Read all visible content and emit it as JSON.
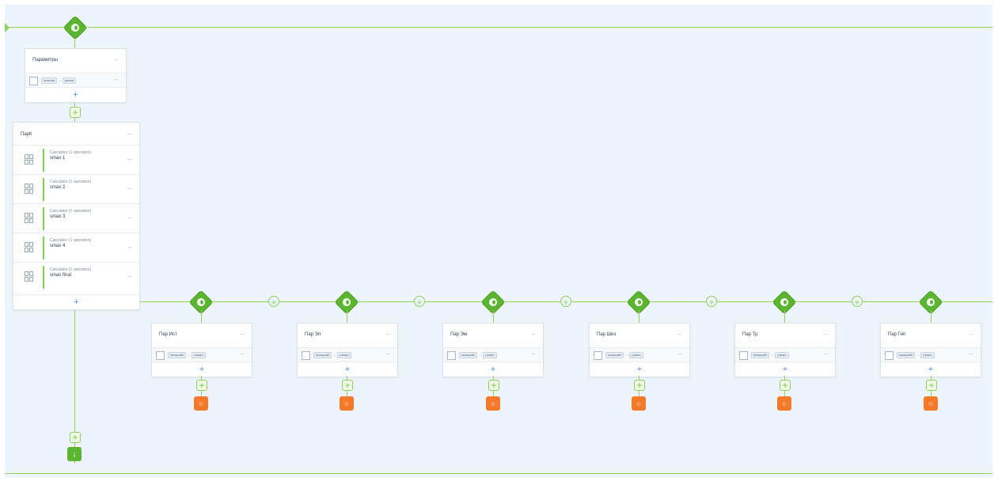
{
  "colors": {
    "canvas_bg": "#edf4fb",
    "connector": "#8fd25e",
    "gate": "#5cb531",
    "reply": "#f47a2a",
    "add": "#4a90e2"
  },
  "top_card": {
    "title": "Параметры",
    "rows": [
      {
        "from": "maxima",
        "to": "param"
      }
    ]
  },
  "calc_card": {
    "title": "ПарК",
    "operations": [
      {
        "type": "Calculator (1 operation)",
        "name": "smax 1"
      },
      {
        "type": "Calculator (1 operation)",
        "name": "smax 2"
      },
      {
        "type": "Calculator (1 operation)",
        "name": "smax 3"
      },
      {
        "type": "Calculator (1 operation)",
        "name": "smax 4"
      },
      {
        "type": "Calculator (1 operation)",
        "name": "smax final"
      }
    ]
  },
  "branch_cards": [
    {
      "title": "Пар Ист",
      "from": "smaxpath",
      "to": "param"
    },
    {
      "title": "Пар Эп",
      "from": "smaxpath",
      "to": "param"
    },
    {
      "title": "Пар Эм",
      "from": "smaxpath",
      "to": "param"
    },
    {
      "title": "Пар Шиз",
      "from": "smaxpath",
      "to": "param"
    },
    {
      "title": "Пар Тр",
      "from": "smaxpath",
      "to": "param"
    },
    {
      "title": "Пар Гип",
      "from": "smaxpath",
      "to": "param"
    }
  ],
  "icons": {
    "gate": "condition-gate-icon",
    "add": "plus-icon",
    "reply": "reply-bubble-icon",
    "down": "arrow-down-icon",
    "menu": "more-dots-icon",
    "calc": "calculator-icon",
    "mapping": "mapping-icon"
  },
  "glyphs": {
    "plus": "+",
    "dots": "···",
    "arrow": "→",
    "down": "↓",
    "reply": "○"
  }
}
